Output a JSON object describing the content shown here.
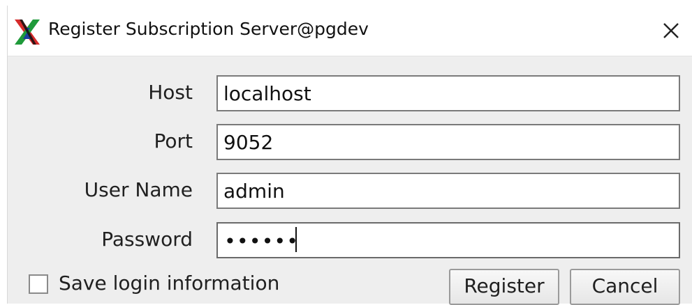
{
  "window": {
    "title": "Register Subscription Server@pgdev"
  },
  "form": {
    "host_label": "Host",
    "host_value": "localhost",
    "port_label": "Port",
    "port_value": "9052",
    "username_label": "User Name",
    "username_value": "admin",
    "password_label": "Password",
    "password_masked": "••••••"
  },
  "options": {
    "save_login_label": "Save login information",
    "save_login_checked": false
  },
  "buttons": {
    "register": "Register",
    "cancel": "Cancel"
  },
  "colors": {
    "window_bg": "#eeeeee",
    "titlebar_bg": "#ffffff",
    "field_border": "#7a7a7a"
  },
  "icons": {
    "app": "x-app-icon",
    "close": "close-icon"
  }
}
